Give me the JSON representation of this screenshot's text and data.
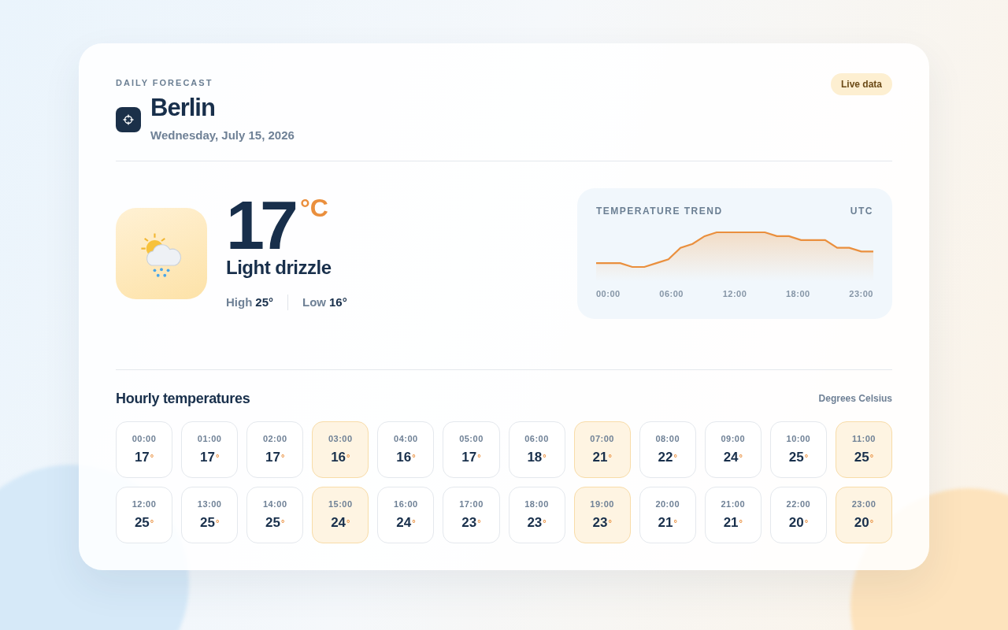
{
  "header": {
    "eyebrow": "DAILY FORECAST",
    "city": "Berlin",
    "date": "Wednesday, July 15, 2026",
    "badge": "Live data"
  },
  "current": {
    "temperature": "17",
    "unit": "°C",
    "condition": "Light drizzle",
    "high_label": "High",
    "high": "25°",
    "low_label": "Low",
    "low": "16°"
  },
  "trend": {
    "title": "TEMPERATURE TREND",
    "timezone": "UTC",
    "x_labels": [
      "00:00",
      "06:00",
      "12:00",
      "18:00",
      "23:00"
    ]
  },
  "hourly": {
    "title": "Hourly temperatures",
    "unit_note": "Degrees Celsius",
    "degree": "°",
    "hours": [
      {
        "time": "00:00",
        "temp": "17",
        "highlighted": false
      },
      {
        "time": "01:00",
        "temp": "17",
        "highlighted": false
      },
      {
        "time": "02:00",
        "temp": "17",
        "highlighted": false
      },
      {
        "time": "03:00",
        "temp": "16",
        "highlighted": true
      },
      {
        "time": "04:00",
        "temp": "16",
        "highlighted": false
      },
      {
        "time": "05:00",
        "temp": "17",
        "highlighted": false
      },
      {
        "time": "06:00",
        "temp": "18",
        "highlighted": false
      },
      {
        "time": "07:00",
        "temp": "21",
        "highlighted": true
      },
      {
        "time": "08:00",
        "temp": "22",
        "highlighted": false
      },
      {
        "time": "09:00",
        "temp": "24",
        "highlighted": false
      },
      {
        "time": "10:00",
        "temp": "25",
        "highlighted": false
      },
      {
        "time": "11:00",
        "temp": "25",
        "highlighted": true
      },
      {
        "time": "12:00",
        "temp": "25",
        "highlighted": false
      },
      {
        "time": "13:00",
        "temp": "25",
        "highlighted": false
      },
      {
        "time": "14:00",
        "temp": "25",
        "highlighted": false
      },
      {
        "time": "15:00",
        "temp": "24",
        "highlighted": true
      },
      {
        "time": "16:00",
        "temp": "24",
        "highlighted": false
      },
      {
        "time": "17:00",
        "temp": "23",
        "highlighted": false
      },
      {
        "time": "18:00",
        "temp": "23",
        "highlighted": false
      },
      {
        "time": "19:00",
        "temp": "23",
        "highlighted": true
      },
      {
        "time": "20:00",
        "temp": "21",
        "highlighted": false
      },
      {
        "time": "21:00",
        "temp": "21",
        "highlighted": false
      },
      {
        "time": "22:00",
        "temp": "20",
        "highlighted": false
      },
      {
        "time": "23:00",
        "temp": "20",
        "highlighted": true
      }
    ]
  }
}
